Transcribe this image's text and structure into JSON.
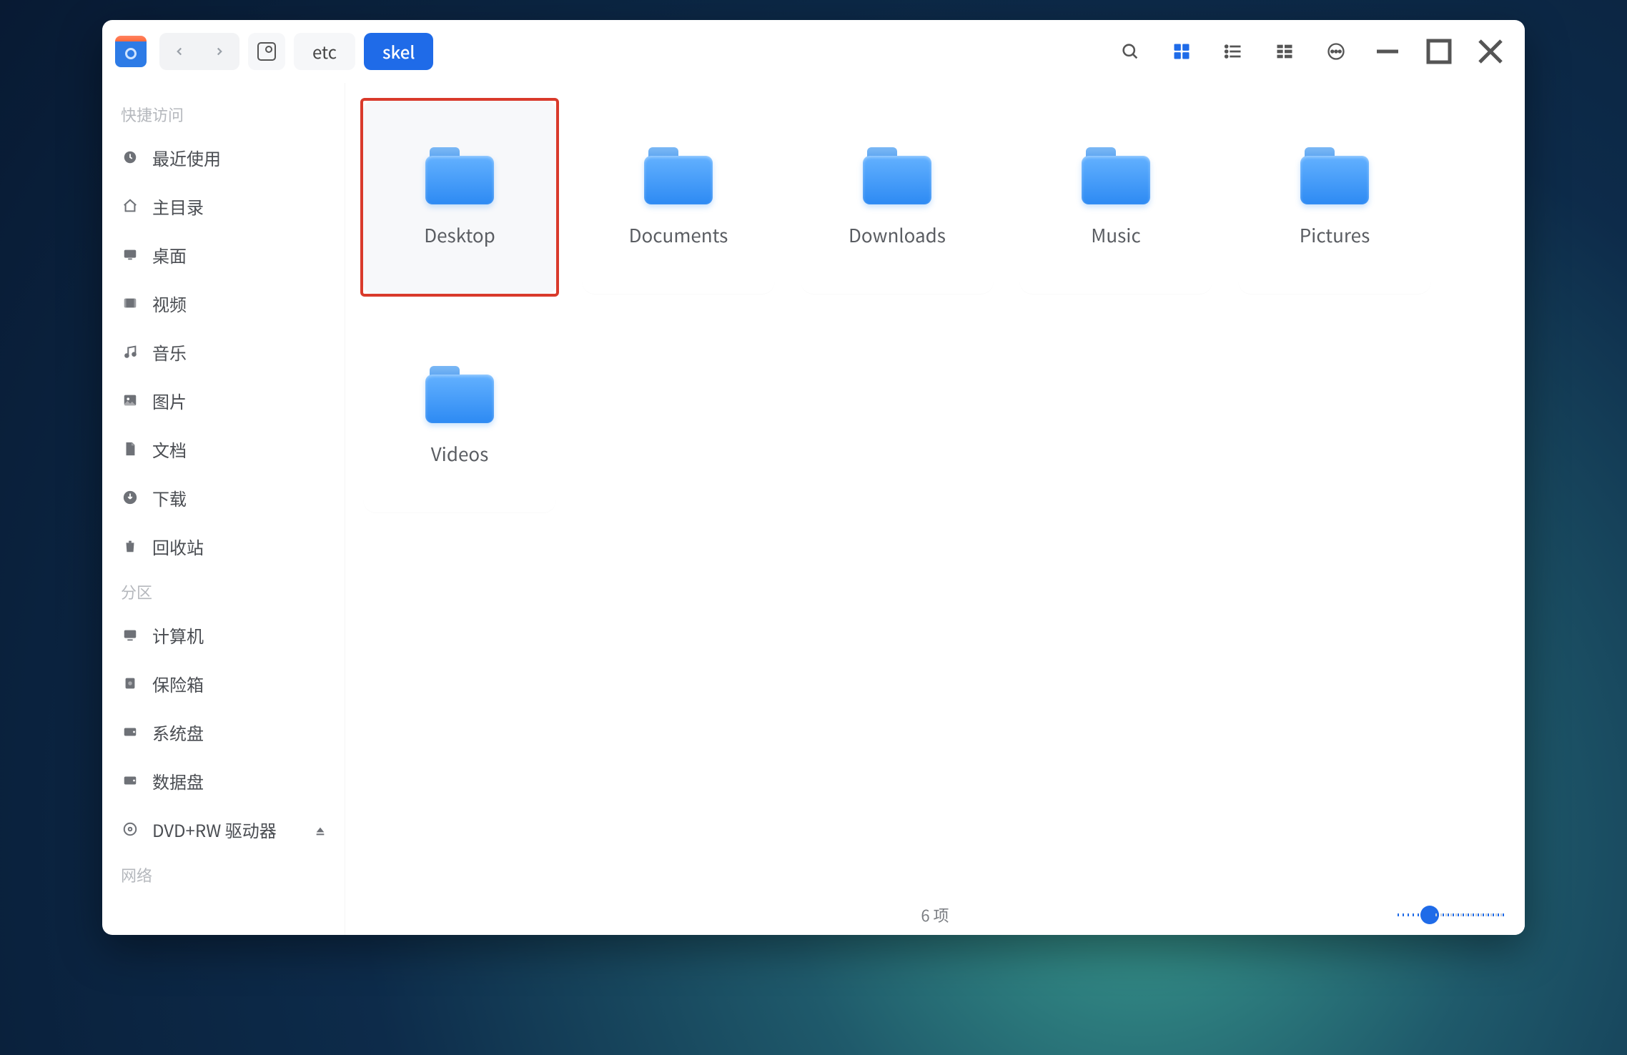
{
  "breadcrumbs": {
    "etc": "etc",
    "skel": "skel"
  },
  "sidebar": {
    "section_quick": "快捷访问",
    "section_partition": "分区",
    "section_network": "网络",
    "items_quick": [
      {
        "label": "最近使用"
      },
      {
        "label": "主目录"
      },
      {
        "label": "桌面"
      },
      {
        "label": "视频"
      },
      {
        "label": "音乐"
      },
      {
        "label": "图片"
      },
      {
        "label": "文档"
      },
      {
        "label": "下载"
      },
      {
        "label": "回收站"
      }
    ],
    "items_partition": [
      {
        "label": "计算机"
      },
      {
        "label": "保险箱"
      },
      {
        "label": "系统盘"
      },
      {
        "label": "数据盘"
      },
      {
        "label": "DVD+RW 驱动器"
      }
    ]
  },
  "folders": [
    {
      "name": "Desktop",
      "selected": true
    },
    {
      "name": "Documents",
      "selected": false
    },
    {
      "name": "Downloads",
      "selected": false
    },
    {
      "name": "Music",
      "selected": false
    },
    {
      "name": "Pictures",
      "selected": false
    },
    {
      "name": "Videos",
      "selected": false
    }
  ],
  "status": "6 项",
  "zoom_percent": 30
}
